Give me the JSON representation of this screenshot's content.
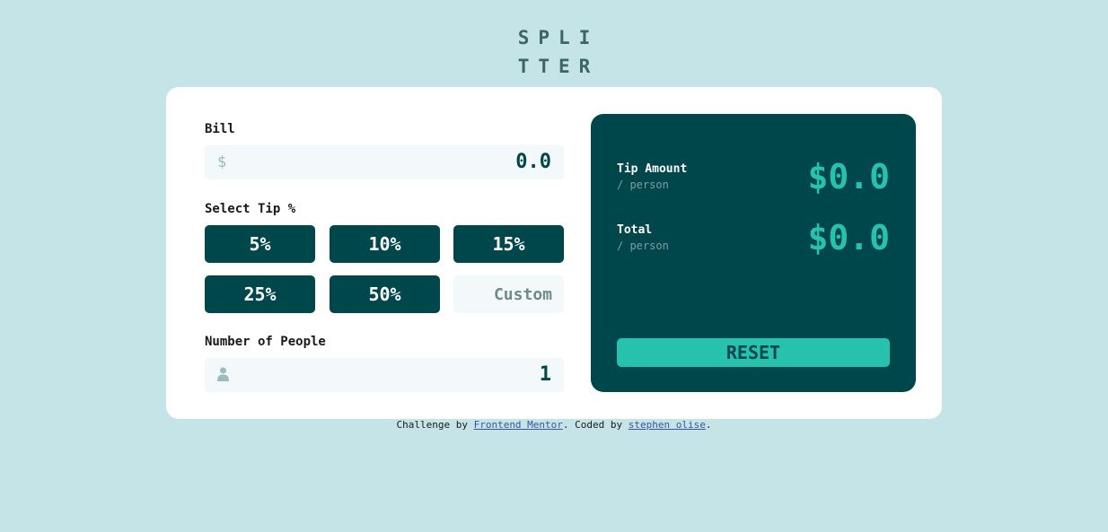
{
  "logo": {
    "line1": "SPLI",
    "line2": "TTER"
  },
  "bill": {
    "label": "Bill",
    "currency_icon": "$",
    "value": "0.0"
  },
  "tip": {
    "label": "Select Tip %",
    "options": [
      "5%",
      "10%",
      "15%",
      "25%",
      "50%"
    ],
    "custom_placeholder": "Custom"
  },
  "people": {
    "label": "Number of People",
    "icon": "person-icon",
    "value": "1"
  },
  "results": {
    "tip_amount_label": "Tip Amount",
    "tip_amount_sub": "/ person",
    "tip_amount_value": "$0.0",
    "total_label": "Total",
    "total_sub": "/ person",
    "total_value": "$0.0",
    "reset_label": "RESET"
  },
  "footer": {
    "prefix": "Challenge by ",
    "link1": "Frontend Mentor",
    "middle": ". Coded by ",
    "link2": "stephen olise",
    "suffix": "."
  },
  "colors": {
    "background": "#c5e4e7",
    "dark_cyan": "#00474b",
    "strong_cyan": "#26c2ad"
  }
}
